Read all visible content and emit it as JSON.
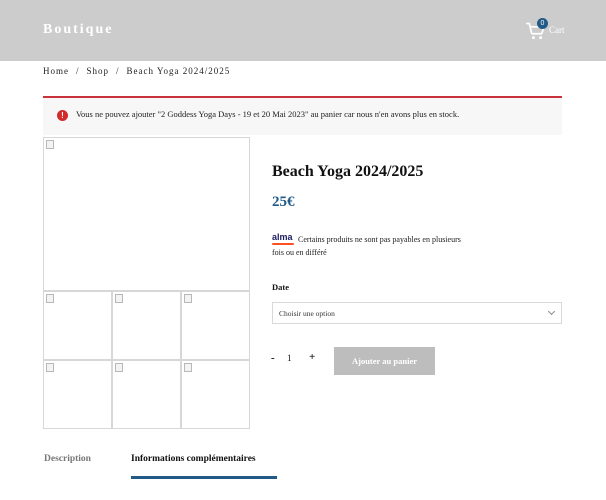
{
  "header": {
    "brand": "Boutique",
    "cart_count": "0",
    "cart_label": "Cart"
  },
  "breadcrumb": {
    "items": [
      "Home",
      "Shop",
      "Beach Yoga 2024/2025"
    ],
    "separator": "/"
  },
  "notice": {
    "icon": "error-icon",
    "text": "Vous ne pouvez ajouter \"2 Goddess Yoga Days - 19 et 20 Mai 2023\" au panier car nous n'en avons plus en stock."
  },
  "product": {
    "title": "Beach Yoga 2024/2025",
    "price": "25€",
    "alma_logo": "alma",
    "alma_text": "Certains produits ne sont pas payables en plusieurs fois ou en différé",
    "date_label": "Date",
    "date_select": "Choisir une option",
    "quantity_minus": "-",
    "quantity": "1",
    "quantity_plus": "+",
    "add_to_cart": "Ajouter au panier"
  },
  "tabs": [
    {
      "label": "Description",
      "active": false
    },
    {
      "label": "Informations complémentaires",
      "active": true
    }
  ],
  "colors": {
    "header_bg": "#cccccc",
    "accent": "#215a86",
    "error": "#c8323a",
    "button_disabled": "#bdbdbd"
  }
}
